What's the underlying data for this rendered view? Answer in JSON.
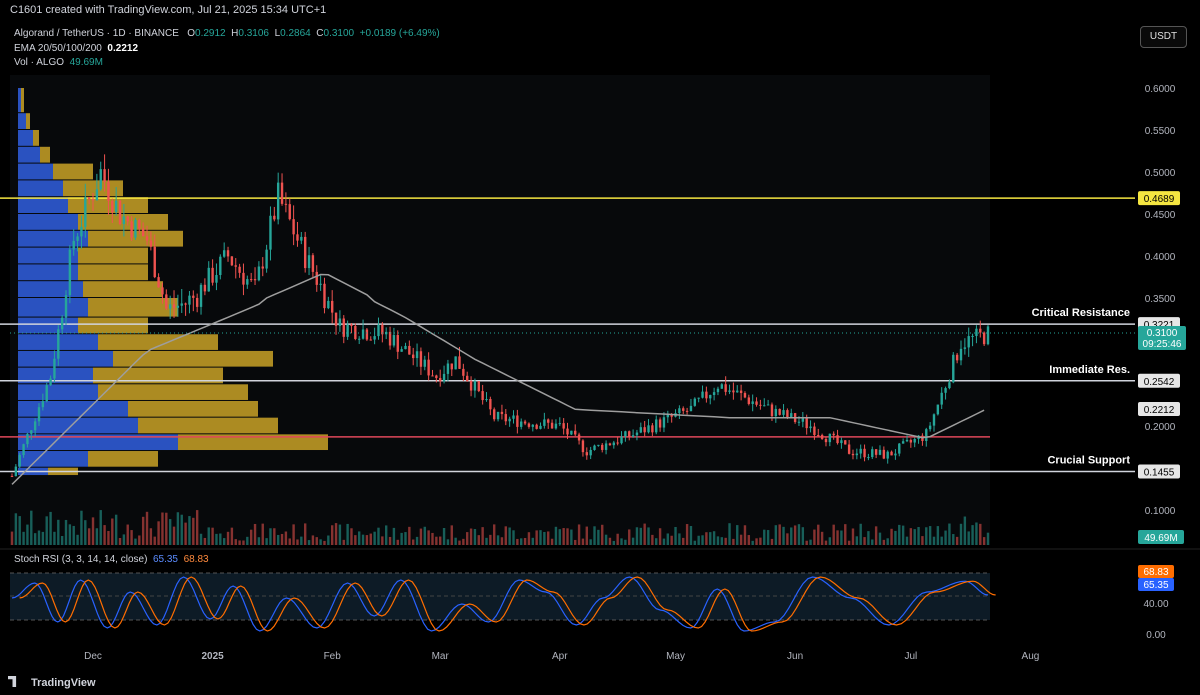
{
  "header": {
    "created_by": "C1601 created with TradingView.com, Jul 21, 2025 15:34 UTC+1",
    "symbol": "Algorand / TetherUS · 1D · BINANCE",
    "ohlc": {
      "o_label": "O",
      "o": "0.2912",
      "h_label": "H",
      "h": "0.3106",
      "l_label": "L",
      "l": "0.2864",
      "c_label": "C",
      "c": "0.3100",
      "change": "+0.0189 (+6.49%)"
    },
    "ema_label": "EMA 20/50/100/200",
    "ema_value": "0.2212",
    "vol_label": "Vol · ALGO",
    "vol_value": "49.69M",
    "currency_button": "USDT"
  },
  "footer": {
    "brand": "TradingView"
  },
  "colors": {
    "bull": "#26a69a",
    "bear": "#ef5350",
    "ema": "#9e9e9e",
    "yellow_line": "#f5e641",
    "red_line": "#e0475a",
    "rsi_k": "#2962ff",
    "rsi_d": "#ff6d00"
  },
  "chart_data": {
    "type": "candlestick",
    "y_ticks": [
      "0.6000",
      "0.5500",
      "0.5000",
      "0.4500",
      "0.4000",
      "0.3500",
      "0.2000",
      "0.1000"
    ],
    "x_ticks": [
      "Dec",
      "2025",
      "Feb",
      "Mar",
      "Apr",
      "May",
      "Jun",
      "Jul",
      "Aug"
    ],
    "horizontal_levels": [
      {
        "label": "",
        "value": 0.4689,
        "tag": "0.4689",
        "color": "#f5e641"
      },
      {
        "label": "Critical Resistance",
        "value": 0.3221,
        "tag": "0.3221",
        "color": "#d1d4dc"
      },
      {
        "label": "Immediate Res.",
        "value": 0.2542,
        "tag": "0.2542",
        "color": "#d1d4dc"
      },
      {
        "label": "",
        "value": 0.187,
        "tag": "",
        "color": "#e0475a"
      },
      {
        "label": "Crucial Support",
        "value": 0.1455,
        "tag": "0.1455",
        "color": "#d1d4dc"
      }
    ],
    "price_tags": {
      "current": "0.3100",
      "countdown": "09:25:46",
      "ema": "0.2212",
      "volume": "49.69M"
    },
    "close_series_anchors": [
      [
        "2024-11-10",
        0.14
      ],
      [
        "2024-11-20",
        0.26
      ],
      [
        "2024-11-26",
        0.42
      ],
      [
        "2024-12-03",
        0.5
      ],
      [
        "2024-12-08",
        0.45
      ],
      [
        "2024-12-15",
        0.42
      ],
      [
        "2024-12-20",
        0.34
      ],
      [
        "2024-12-27",
        0.35
      ],
      [
        "2025-01-05",
        0.4
      ],
      [
        "2025-01-12",
        0.36
      ],
      [
        "2025-01-18",
        0.47
      ],
      [
        "2025-01-25",
        0.4
      ],
      [
        "2025-02-03",
        0.32
      ],
      [
        "2025-02-15",
        0.31
      ],
      [
        "2025-02-28",
        0.26
      ],
      [
        "2025-03-05",
        0.28
      ],
      [
        "2025-03-15",
        0.21
      ],
      [
        "2025-04-01",
        0.2
      ],
      [
        "2025-04-08",
        0.17
      ],
      [
        "2025-04-20",
        0.19
      ],
      [
        "2025-05-05",
        0.22
      ],
      [
        "2025-05-12",
        0.25
      ],
      [
        "2025-05-25",
        0.22
      ],
      [
        "2025-06-05",
        0.2
      ],
      [
        "2025-06-15",
        0.17
      ],
      [
        "2025-06-25",
        0.165
      ],
      [
        "2025-07-05",
        0.19
      ],
      [
        "2025-07-10",
        0.25
      ],
      [
        "2025-07-14",
        0.3
      ],
      [
        "2025-07-21",
        0.31
      ]
    ],
    "ema_series_anchors": [
      [
        "2024-11-10",
        0.13
      ],
      [
        "2024-12-15",
        0.29
      ],
      [
        "2025-01-10",
        0.34
      ],
      [
        "2025-01-30",
        0.38
      ],
      [
        "2025-02-20",
        0.33
      ],
      [
        "2025-03-10",
        0.28
      ],
      [
        "2025-04-05",
        0.22
      ],
      [
        "2025-05-15",
        0.21
      ],
      [
        "2025-06-10",
        0.21
      ],
      [
        "2025-07-05",
        0.185
      ],
      [
        "2025-07-21",
        0.2212
      ]
    ],
    "stoch_rsi": {
      "title": "Stoch RSI (3, 3, 14, 14, close)",
      "k_value": "65.35",
      "d_value": "68.83",
      "y_ticks": [
        "40.00",
        "0.00"
      ],
      "k_anchors": [
        [
          0,
          60
        ],
        [
          6,
          85
        ],
        [
          12,
          20
        ],
        [
          18,
          90
        ],
        [
          25,
          10
        ],
        [
          31,
          70
        ],
        [
          38,
          15
        ],
        [
          45,
          95
        ],
        [
          52,
          25
        ],
        [
          58,
          80
        ],
        [
          65,
          5
        ],
        [
          72,
          60
        ],
        [
          80,
          10
        ],
        [
          88,
          85
        ],
        [
          95,
          30
        ],
        [
          102,
          90
        ],
        [
          110,
          5
        ],
        [
          118,
          50
        ],
        [
          125,
          20
        ],
        [
          133,
          90
        ],
        [
          140,
          70
        ],
        [
          148,
          15
        ],
        [
          155,
          60
        ],
        [
          162,
          95
        ],
        [
          170,
          40
        ],
        [
          178,
          10
        ],
        [
          185,
          75
        ],
        [
          192,
          5
        ],
        [
          200,
          20
        ],
        [
          210,
          95
        ],
        [
          220,
          60
        ],
        [
          230,
          15
        ],
        [
          240,
          70
        ],
        [
          250,
          88
        ],
        [
          256,
          65
        ]
      ]
    }
  }
}
